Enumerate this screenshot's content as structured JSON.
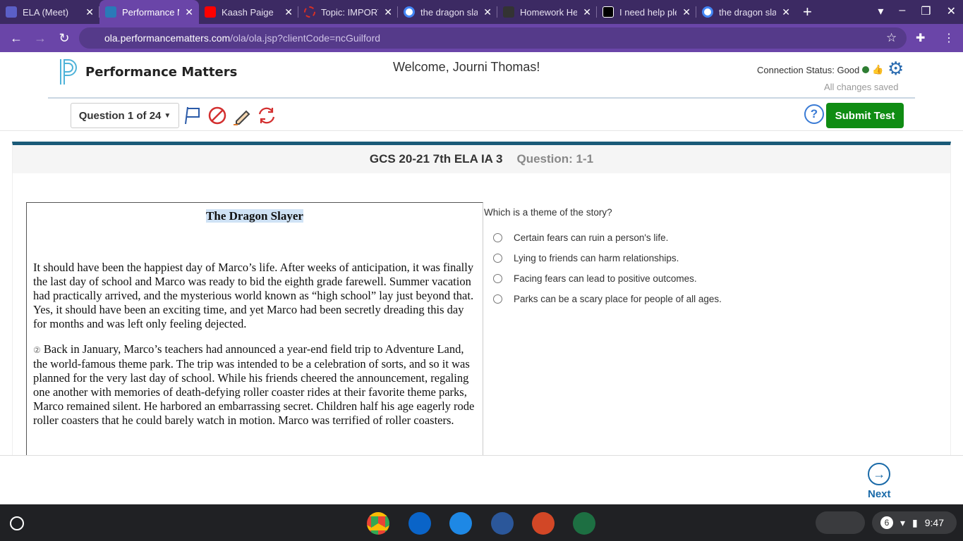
{
  "browser": {
    "tabs": [
      {
        "title": "ELA (Meet)",
        "color": "#5b5fc7"
      },
      {
        "title": "Performance Matters",
        "color": "#2a7ab8",
        "active": true
      },
      {
        "title": "Kaash Paige",
        "color": "#ff0000"
      },
      {
        "title": "Topic: IMPORTANT",
        "color": "#d93025"
      },
      {
        "title": "the dragon slayer",
        "color": "#4285f4"
      },
      {
        "title": "Homework Help",
        "color": "#333333"
      },
      {
        "title": "I need help please",
        "color": "#000000"
      },
      {
        "title": "the dragon slayer",
        "color": "#4285f4"
      }
    ],
    "url_host": "ola.performancematters.com",
    "url_path": "/ola/ola.jsp?clientCode=ncGuilford"
  },
  "header": {
    "brand": "Performance Matters",
    "welcome": "Welcome, Journi Thomas!",
    "connection": "Connection Status: Good",
    "saved": "All changes saved",
    "question_selector": "Question 1 of 24",
    "help": "?",
    "submit": "Submit Test"
  },
  "card": {
    "test_name": "GCS 20-21 7th ELA IA 3",
    "question_label": "Question: 1-1"
  },
  "passage": {
    "title": "The Dragon Slayer",
    "paragraphs": [
      "It should have been the happiest day of Marco’s life. After weeks of anticipation, it was finally the last day of school and Marco was ready to bid the eighth grade farewell. Summer vacation had practically arrived, and the mysterious world known as “high school” lay just beyond that. Yes, it should have been an exciting time, and yet Marco had been secretly dreading this day for months and was left only feeling dejected.",
      "Back in January, Marco’s teachers had announced a year-end field trip to Adventure Land, the world-famous theme park. The trip was intended to be a celebration of sorts, and so it was planned for the very last day of school. While his friends cheered the announcement, regaling one another with memories of death-defying roller coaster rides at their favorite theme parks, Marco remained silent. He harbored an embarrassing secret. Children half his age eagerly rode roller coasters that he could barely watch in motion. Marco was terrified of roller coasters."
    ],
    "paragraph_marker": "②"
  },
  "question": {
    "prompt": "Which is a theme of the story?",
    "options": [
      "Certain fears can ruin a person's life.",
      "Lying to friends can harm relationships.",
      "Facing fears can lead to positive outcomes.",
      "Parks can be a scary place for people of all ages."
    ]
  },
  "footer": {
    "next": "Next"
  },
  "shelf": {
    "notifications": "6",
    "time": "9:47"
  }
}
